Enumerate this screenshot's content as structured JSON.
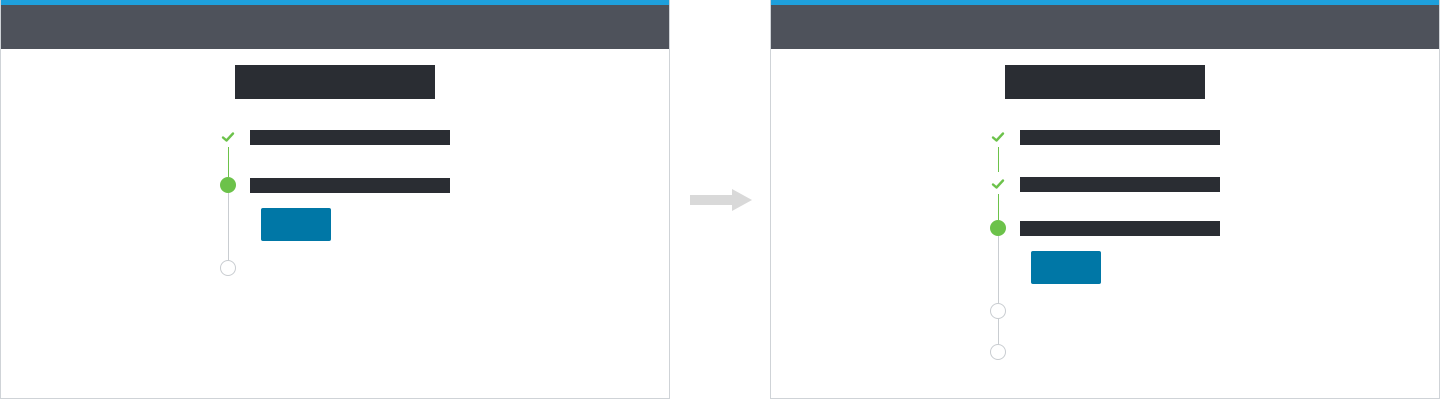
{
  "colors": {
    "accent": "#1ea0dc",
    "header": "#4e525b",
    "text_block": "#2a2d33",
    "complete": "#6cc24a",
    "pending": "#c9cdd1",
    "button": "#0077a6",
    "arrow": "#d9d9d9"
  },
  "before_screen": {
    "steps": [
      {
        "status": "complete",
        "icon": "check-icon"
      },
      {
        "status": "current",
        "icon": "current-step-dot-icon",
        "has_action_button": true
      },
      {
        "status": "pending",
        "icon": "pending-step-circle-icon"
      }
    ]
  },
  "transition": {
    "icon": "right-arrow-icon"
  },
  "after_screen": {
    "steps": [
      {
        "status": "complete",
        "icon": "check-icon"
      },
      {
        "status": "complete",
        "icon": "check-icon"
      },
      {
        "status": "current",
        "icon": "current-step-dot-icon",
        "has_action_button": true
      },
      {
        "status": "pending",
        "icon": "pending-step-circle-icon"
      },
      {
        "status": "pending",
        "icon": "pending-step-circle-icon"
      }
    ]
  }
}
